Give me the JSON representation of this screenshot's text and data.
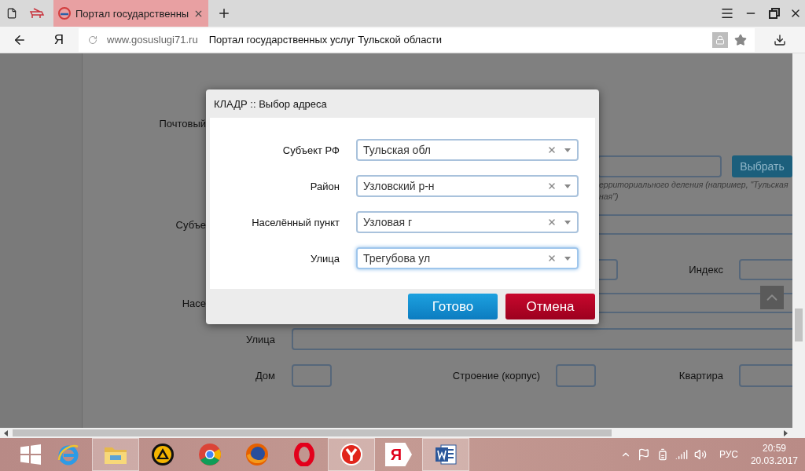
{
  "browser": {
    "tabs": [
      {
        "kind": "pinned",
        "selected": false
      },
      {
        "kind": "page",
        "title": "Портал государственны",
        "selected": true
      }
    ],
    "address_bar": {
      "logo_letter": "Я",
      "url": "www.gosuslugi71.ru",
      "page_title": "Портал государственных услуг Тульской области"
    }
  },
  "form": {
    "postal_label": "Почтовый",
    "select_button": "Выбрать",
    "hint_lines": [
      "ерриториального деления (например, \"Тульская",
      "ная\")"
    ],
    "subject_label": "Субъе",
    "index_label": "Индекс",
    "settlement_label": "Насе",
    "street_label": "Улица",
    "house_label": "Дом",
    "building_label": "Строение (корпус)",
    "apartment_label": "Квартира"
  },
  "dialog": {
    "title": "КЛАДР :: Выбор адреса",
    "fields": [
      {
        "label": "Субъект РФ",
        "value": "Тульская обл",
        "focused": false
      },
      {
        "label": "Район",
        "value": "Узловский р-н",
        "focused": false
      },
      {
        "label": "Населённый пункт",
        "value": "Узловая г",
        "focused": false
      },
      {
        "label": "Улица",
        "value": "Трегубова ул",
        "focused": true
      }
    ],
    "buttons": [
      {
        "label": "Готово",
        "kind": "primary"
      },
      {
        "label": "Отмена",
        "kind": "danger"
      }
    ]
  },
  "taskbar": {
    "apps": [
      {
        "kind": "ie",
        "open": false
      },
      {
        "kind": "explorer",
        "open": true
      },
      {
        "kind": "aimp",
        "open": false
      },
      {
        "kind": "chrome",
        "open": false
      },
      {
        "kind": "firefox",
        "open": false
      },
      {
        "kind": "opera",
        "open": false
      },
      {
        "kind": "yandex-browser",
        "open": true
      },
      {
        "kind": "yandex",
        "letter": "Я",
        "open": false
      },
      {
        "kind": "word",
        "open": true
      }
    ],
    "language": "РУС",
    "time": "20:59",
    "date": "20.03.2017"
  }
}
